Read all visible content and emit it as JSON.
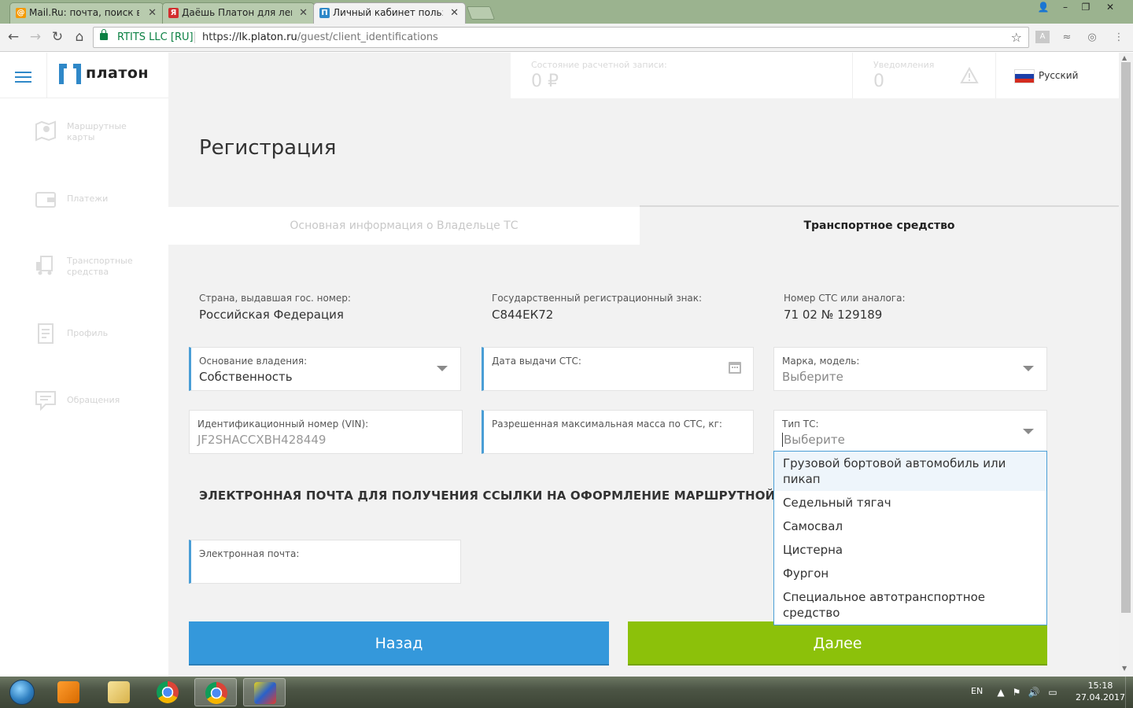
{
  "browser": {
    "tabs": [
      {
        "title": "Mail.Ru: почта, поиск в",
        "favicon": "@",
        "favicon_color": "#f59a00"
      },
      {
        "title": "Даёшь Платон для легк",
        "favicon": "Я",
        "favicon_color": "#d22e2e"
      },
      {
        "title": "Личный кабинет пользо",
        "favicon": "П",
        "favicon_color": "#2f88c8"
      }
    ],
    "cert_label": "RTITS LLC [RU]",
    "url_scheme": "https://",
    "url_host": "lk.platon.ru",
    "url_path": "/guest/client_identifications"
  },
  "header": {
    "logo_text": "платон",
    "balance_label": "Состояние расчетной записи:",
    "balance_value": "0 ₽",
    "notifications_label": "Уведомления",
    "notifications_value": "0",
    "language": "Русский"
  },
  "sidebar": {
    "items": [
      {
        "label": "Маршрутные карты",
        "icon": "map-pin-icon"
      },
      {
        "label": "Платежи",
        "icon": "wallet-icon"
      },
      {
        "label": "Транспортные средства",
        "icon": "truck-icon"
      },
      {
        "label": "Профиль",
        "icon": "document-icon"
      },
      {
        "label": "Обращения",
        "icon": "chat-icon"
      }
    ]
  },
  "form": {
    "title": "Регистрация",
    "tabs": [
      {
        "label": "Основная информация о Владельце ТС",
        "active": false
      },
      {
        "label": "Транспортное средство",
        "active": true
      }
    ],
    "info": [
      {
        "label": "Страна, выдавшая гос. номер:",
        "value": "Российская Федерация"
      },
      {
        "label": "Государственный регистрационный знак:",
        "value": "С844ЕК72"
      },
      {
        "label": "Номер СТС или аналога:",
        "value": "71 02 № 129189"
      }
    ],
    "fields": {
      "ownership_label": "Основание владения:",
      "ownership_value": "Собственность",
      "sts_date_label": "Дата выдачи СТС:",
      "sts_date_value": "",
      "brand_label": "Марка, модель:",
      "brand_placeholder": "Выберите",
      "vin_label": "Идентификационный номер (VIN):",
      "vin_value": "JF2SHACCXBH428449",
      "mass_label": "Разрешенная максимальная масса по СТС, кг:",
      "mass_value": "",
      "type_label": "Тип ТС:",
      "type_placeholder": "Выберите"
    },
    "email_section_title": "ЭЛЕКТРОННАЯ ПОЧТА ДЛЯ ПОЛУЧЕНИЯ ССЫЛКИ НА ОФОРМЛЕНИЕ МАРШРУТНОЙ КАРТЫ",
    "email_label": "Электронная почта:",
    "email_value": "",
    "type_options": [
      "Грузовой бортовой автомобиль или пикап",
      "Седельный тягач",
      "Самосвал",
      "Цистерна",
      "Фургон",
      "Специальное автотранспортное средство"
    ],
    "back_button": "Назад",
    "next_button": "Далее"
  },
  "taskbar": {
    "lang": "EN",
    "time": "15:18",
    "date": "27.04.2017"
  },
  "colors": {
    "accent_blue": "#3498db",
    "accent_green": "#8cc10a",
    "field_border": "#4a9ed6"
  }
}
